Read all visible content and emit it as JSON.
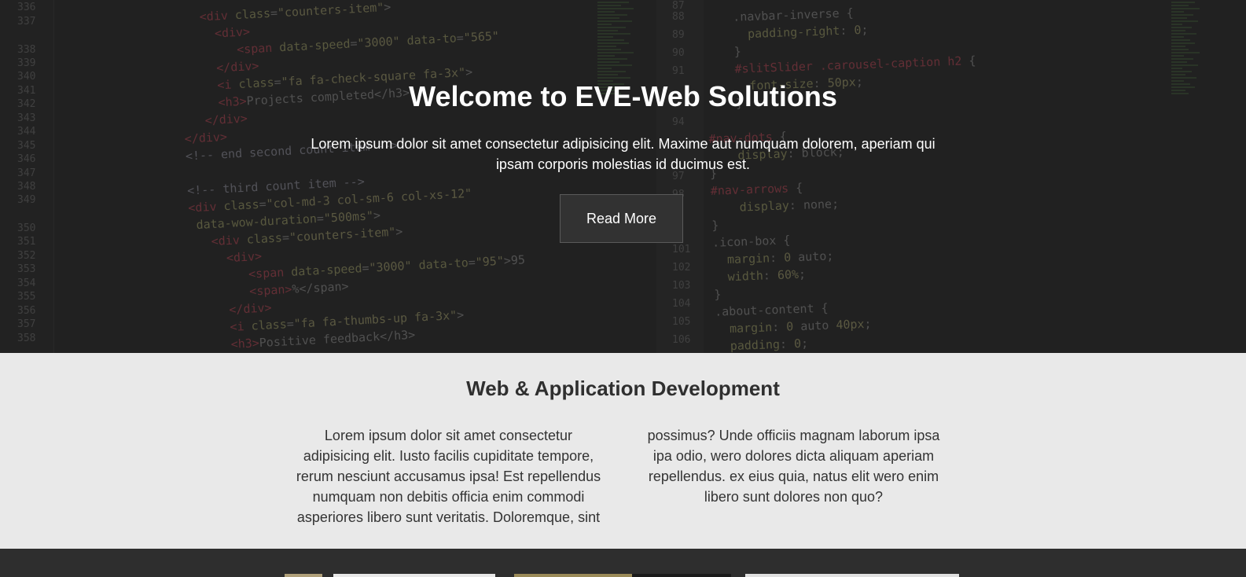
{
  "hero": {
    "title": "Welcome to EVE-Web Solutions",
    "text": "Lorem ipsum dolor sit amet consectetur adipisicing elit. Maxime aut numquam dolorem, aperiam qui ipsam corporis molestias id ducimus est.",
    "button_label": "Read More"
  },
  "service": {
    "title": "Web & Application Development",
    "text": "Lorem ipsum dolor sit amet consectetur adipisicing elit. Iusto facilis cupiditate tempore, rerum nesciunt accusamus ipsa! Est repellendus numquam non debitis officia enim commodi asperiores libero sunt veritatis. Doloremque, sint possimus? Unde officiis magnam laborum ipsa ipa odio, wero dolores dicta aliquam aperiam repellendus. ex eius quia, natus elit wero enim libero sunt dolores non quo?"
  }
}
